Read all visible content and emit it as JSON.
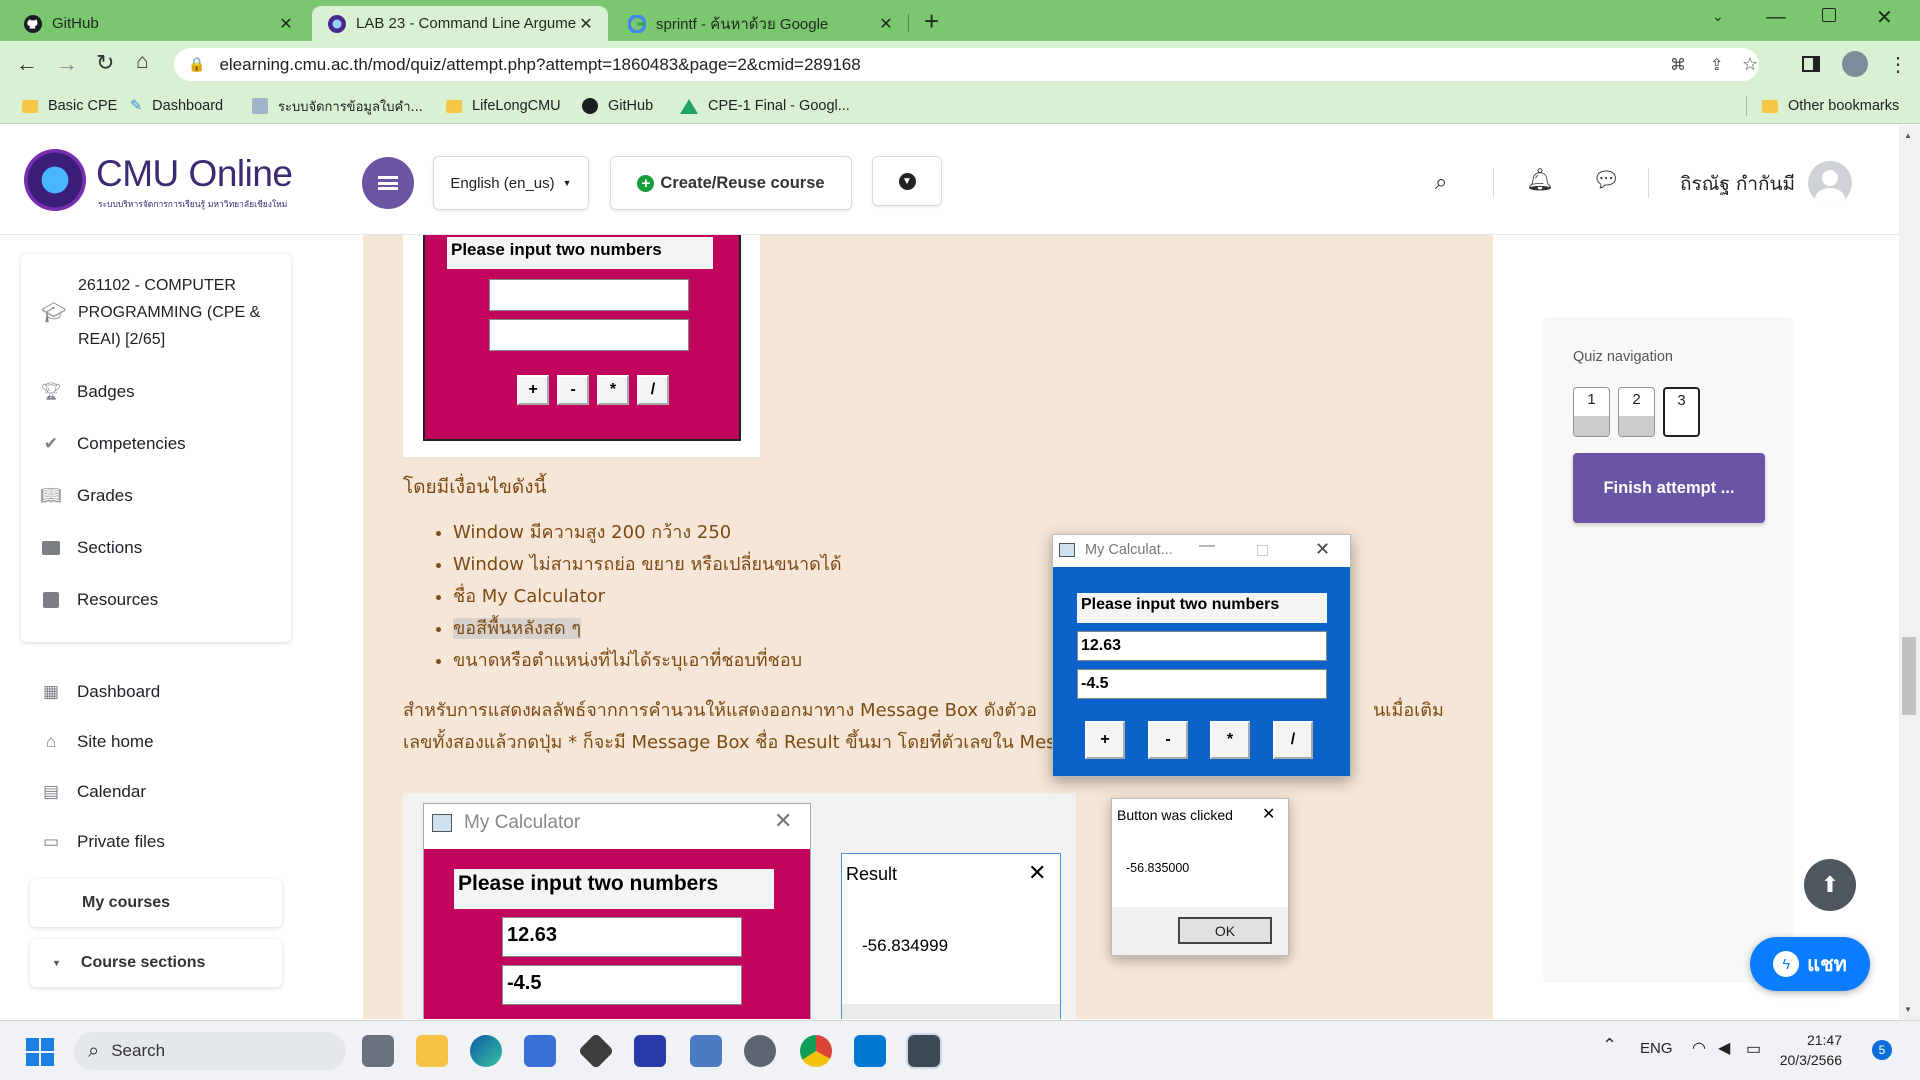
{
  "browser": {
    "tabs": [
      {
        "label": "GitHub"
      },
      {
        "label": "LAB 23 - Command Line Argume"
      },
      {
        "label": "sprintf - ค้นหาด้วย Google"
      }
    ],
    "url": "elearning.cmu.ac.th/mod/quiz/attempt.php?attempt=1860483&page=2&cmid=289168",
    "bookmarks": [
      "Basic CPE",
      "Dashboard",
      "ระบบจัดการข้อมูลใบคำ...",
      "LifeLongCMU",
      "GitHub",
      "CPE-1 Final - Googl..."
    ],
    "other_bookmarks": "Other bookmarks"
  },
  "header": {
    "logo_text": "CMU Online",
    "logo_sub": "ระบบบริหารจัดการการเรียนรู้ มหาวิทยาลัยเชียงใหม่",
    "language": "English (en_us)",
    "create_course": "Create/Reuse course",
    "user_name": "ถิรณัฐ กำกันมี"
  },
  "sidebar": {
    "course_title": "261102 - COMPUTER PROGRAMMING (CPE & REAI) [2/65]",
    "course_items": [
      "Badges",
      "Competencies",
      "Grades",
      "Sections",
      "Resources"
    ],
    "nav_items": [
      "Dashboard",
      "Site home",
      "Calendar",
      "Private files"
    ],
    "my_courses": "My courses",
    "course_sections": "Course sections"
  },
  "content": {
    "calc_label": "Please input two numbers",
    "buttons": [
      "+",
      "-",
      "*",
      "/"
    ],
    "conditions_heading": "โดยมีเงื่อนไขดังนี้",
    "conditions": [
      "Window มีความสูง 200 กว้าง 250",
      "Window ไม่สามารถย่อ ขยาย หรือเปลี่ยนขนาดได้",
      "ชื่อ My Calculator",
      "ขอสีพื้นหลังสด ๆ",
      "ขนาดหรือตำแหน่งที่ไม่ได้ระบุเอาที่ชอบที่ชอบ"
    ],
    "paragraph_line1": "สำหรับการแสดงผลลัพธ์จากการคำนวนให้แสดงออกมาทาง Message Box  ดังตัวอ",
    "paragraph_line1_end": "นเมื่อเติม",
    "paragraph_line2": "เลขทั้งสองแล้วกดปุ่ม * ก็จะมี Message Box ชื่อ Result ขึ้นมา โดยที่ตัวเลขใน Mes",
    "example_title": "My Calculator",
    "example_val1": "12.63",
    "example_val2": "-4.5",
    "result_title": "Result",
    "result_value": "-56.834999"
  },
  "floating_calc": {
    "title": "My Calculat...",
    "label": "Please input two numbers",
    "val1": "12.63",
    "val2": "-4.5",
    "buttons": [
      "+",
      "-",
      "*",
      "/"
    ]
  },
  "msgbox": {
    "title": "Button was clicked",
    "value": "-56.835000",
    "ok": "OK"
  },
  "quiz_nav": {
    "title": "Quiz navigation",
    "pages": [
      "1",
      "2",
      "3"
    ],
    "finish": "Finish attempt ..."
  },
  "chat_button": "แชท",
  "taskbar": {
    "search": "Search",
    "lang": "ENG",
    "time": "21:47",
    "date": "20/3/2566",
    "badge": "5"
  },
  "colors": {
    "chrome_tabbar": "#7bc76f",
    "chrome_toolbar": "#d9f1d2",
    "moodle_purple": "#6a54a4",
    "calc_magenta": "#c1045c",
    "calc_blue": "#0a63c9",
    "content_bg": "#f6e6d7"
  }
}
